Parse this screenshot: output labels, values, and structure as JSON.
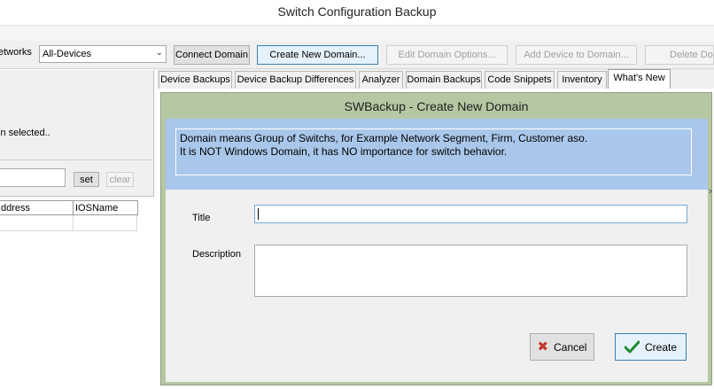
{
  "window": {
    "title": "Switch Configuration Backup"
  },
  "toolbar": {
    "networks_label": "etworks",
    "networks_select": "All-Devices",
    "buttons": [
      {
        "label": "Connect Domain",
        "enabled": true
      },
      {
        "label": "Create New Domain...",
        "enabled": true
      },
      {
        "label": "Edit Domain Options...",
        "enabled": false
      },
      {
        "label": "Add Device to Domain...",
        "enabled": false
      },
      {
        "label": "Delete Dor",
        "enabled": false
      }
    ]
  },
  "left_panel": {
    "selected_text": "in selected..",
    "set_label": "set",
    "clear_label": "clear",
    "grid_columns": [
      "ddress",
      "IOSName"
    ]
  },
  "tabs": [
    {
      "label": "Device Backups",
      "active": false
    },
    {
      "label": "Device Backup Differences",
      "active": false
    },
    {
      "label": "Analyzer",
      "active": false
    },
    {
      "label": "Domain Backups",
      "active": false
    },
    {
      "label": "Code Snippets",
      "active": false
    },
    {
      "label": "Inventory",
      "active": false
    },
    {
      "label": "What's New",
      "active": true
    }
  ],
  "dialog": {
    "title": "SWBackup - Create New Domain",
    "info_line1": "Domain means Group of Switchs, for Example Network Segment, Firm, Customer aso.",
    "info_line2": "It is NOT Windows Domain, it has NO importance for switch behavior.",
    "title_label": "Title",
    "title_value": "",
    "description_label": "Description",
    "description_value": "",
    "cancel_label": "Cancel",
    "create_label": "Create"
  },
  "colors": {
    "dialog_frame": "#b6c7a3",
    "info_band": "#a9c7ea",
    "cancel_icon": "#c0392b",
    "create_icon": "#1e8a2e"
  }
}
